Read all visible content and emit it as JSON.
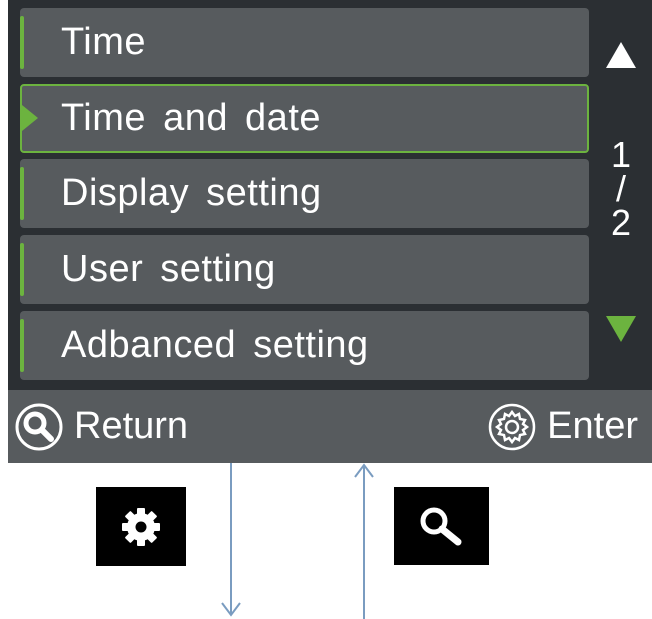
{
  "menu": {
    "items": [
      {
        "label": "Time",
        "selected": false
      },
      {
        "label": "Time and date",
        "selected": true
      },
      {
        "label": "Display setting",
        "selected": false
      },
      {
        "label": "User setting",
        "selected": false
      },
      {
        "label": "Adbanced setting",
        "selected": false
      }
    ]
  },
  "pagination": {
    "current": "1",
    "separator": "/",
    "total": "2"
  },
  "footer": {
    "return_label": "Return",
    "return_icon": "search-icon",
    "enter_label": "Enter",
    "enter_icon": "gear-icon"
  },
  "hardware_buttons": [
    {
      "icon": "gear-icon"
    },
    {
      "icon": "search-icon"
    }
  ],
  "colors": {
    "screen_background": "#2b2f33",
    "item_background": "#575b5e",
    "accent_green": "#6cb33f",
    "text": "#ffffff",
    "flow_arrow": "#7a9cc0"
  }
}
